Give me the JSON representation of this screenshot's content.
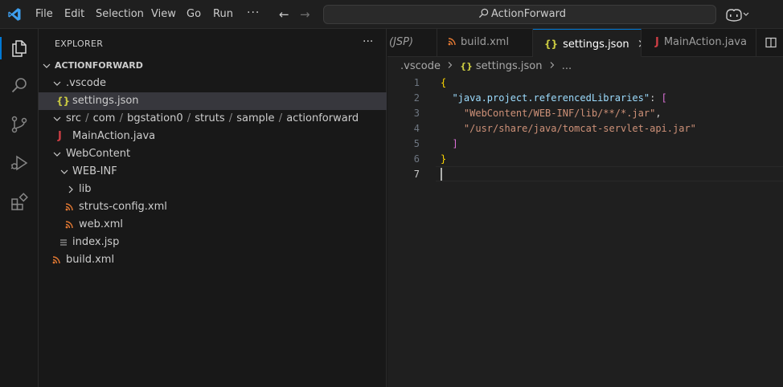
{
  "menu": [
    "File",
    "Edit",
    "Selection",
    "View",
    "Go",
    "Run"
  ],
  "titlebar": {
    "more": "···",
    "search_text": "ActionForward",
    "back_arrow": "←",
    "forward_arrow": "→"
  },
  "activity_bar": [
    "explorer-icon",
    "search-icon",
    "source-control-icon",
    "run-debug-icon",
    "extensions-icon"
  ],
  "sidebar": {
    "title": "EXPLORER",
    "more": "···",
    "root": "ACTIONFORWARD",
    "tree": {
      "vscode": ".vscode",
      "settings": "settings.json",
      "src_path": [
        "src",
        "com",
        "bgstation0",
        "struts",
        "sample",
        "actionforward"
      ],
      "main_action": "MainAction.java",
      "webcontent": "WebContent",
      "webinf": "WEB-INF",
      "lib": "lib",
      "struts_config": "struts-config.xml",
      "web_xml": "web.xml",
      "index_jsp": "index.jsp",
      "build_xml": "build.xml"
    }
  },
  "tabs": [
    {
      "label": "(JSP)",
      "icon": ""
    },
    {
      "label": "build.xml",
      "icon": "xml-icon"
    },
    {
      "label": "settings.json",
      "icon": "json-icon",
      "active": true,
      "close": "×"
    },
    {
      "label": "MainAction.java",
      "icon": "java-icon"
    }
  ],
  "breadcrumbs": {
    "folder": ".vscode",
    "file": "settings.json",
    "more": "..."
  },
  "code": {
    "line_numbers": [
      "1",
      "2",
      "3",
      "4",
      "5",
      "6",
      "7"
    ],
    "open_brace": "{",
    "key": "\"java.project.referencedLibraries\"",
    "colon": ": ",
    "open_bracket": "[",
    "lib1": "\"WebContent/WEB-INF/lib/**/*.jar\"",
    "comma": ",",
    "lib2": "\"/usr/share/java/tomcat-servlet-api.jar\"",
    "close_bracket": "]",
    "close_brace": "}"
  },
  "colors": {
    "accent": "#0078d4",
    "json_icon": "#cbcb41",
    "xml_icon": "#e37933",
    "java_icon": "#cc3e44"
  }
}
